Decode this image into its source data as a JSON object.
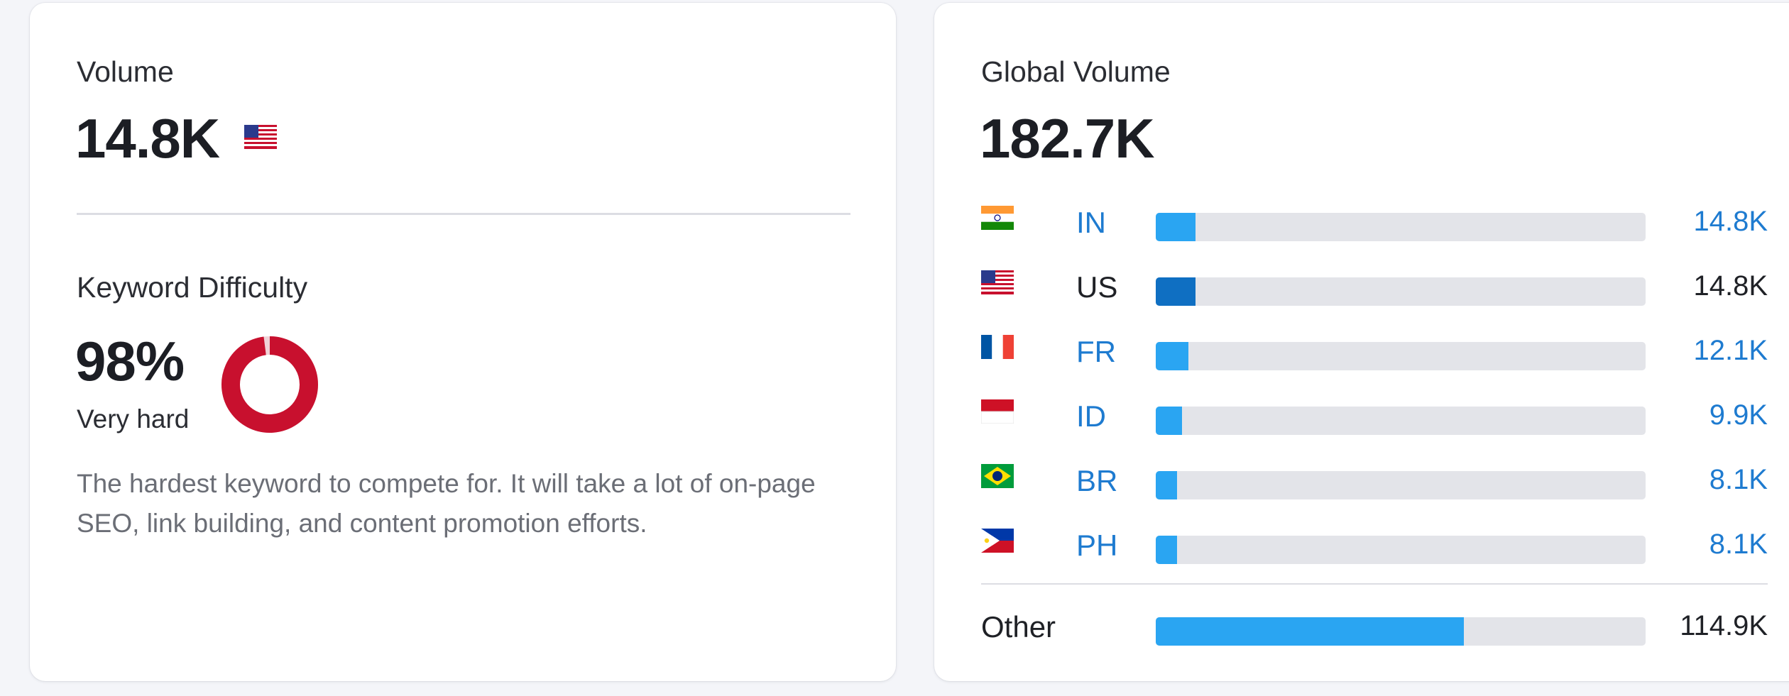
{
  "volume": {
    "label": "Volume",
    "value": "14.8K",
    "flag_icon": "us-flag-icon"
  },
  "keyword_difficulty": {
    "label": "Keyword Difficulty",
    "value": "98%",
    "level": "Very hard",
    "percent": 98,
    "color": "#c8102e",
    "description": "The hardest keyword to compete for. It will take a lot of on-page SEO, link building, and content promotion efforts."
  },
  "global_volume": {
    "label": "Global Volume",
    "value": "182.7K",
    "countries": [
      {
        "code": "IN",
        "value": "14.8K",
        "fraction": 0.081,
        "linked": true,
        "highlight": false,
        "flag_icon": "india-flag-icon"
      },
      {
        "code": "US",
        "value": "14.8K",
        "fraction": 0.081,
        "linked": false,
        "highlight": true,
        "flag_icon": "us-flag-icon"
      },
      {
        "code": "FR",
        "value": "12.1K",
        "fraction": 0.066,
        "linked": true,
        "highlight": false,
        "flag_icon": "france-flag-icon"
      },
      {
        "code": "ID",
        "value": "9.9K",
        "fraction": 0.054,
        "linked": true,
        "highlight": false,
        "flag_icon": "indonesia-flag-icon"
      },
      {
        "code": "BR",
        "value": "8.1K",
        "fraction": 0.044,
        "linked": true,
        "highlight": false,
        "flag_icon": "brazil-flag-icon"
      },
      {
        "code": "PH",
        "value": "8.1K",
        "fraction": 0.044,
        "linked": true,
        "highlight": false,
        "flag_icon": "philippines-flag-icon"
      }
    ],
    "other": {
      "label": "Other",
      "value": "114.9K",
      "fraction": 0.629
    }
  },
  "colors": {
    "bar_fill": "#2aa5f2",
    "bar_fill_highlight": "#0f6fc2",
    "bar_track": "#e3e4e9",
    "link": "#1e7bd0"
  }
}
